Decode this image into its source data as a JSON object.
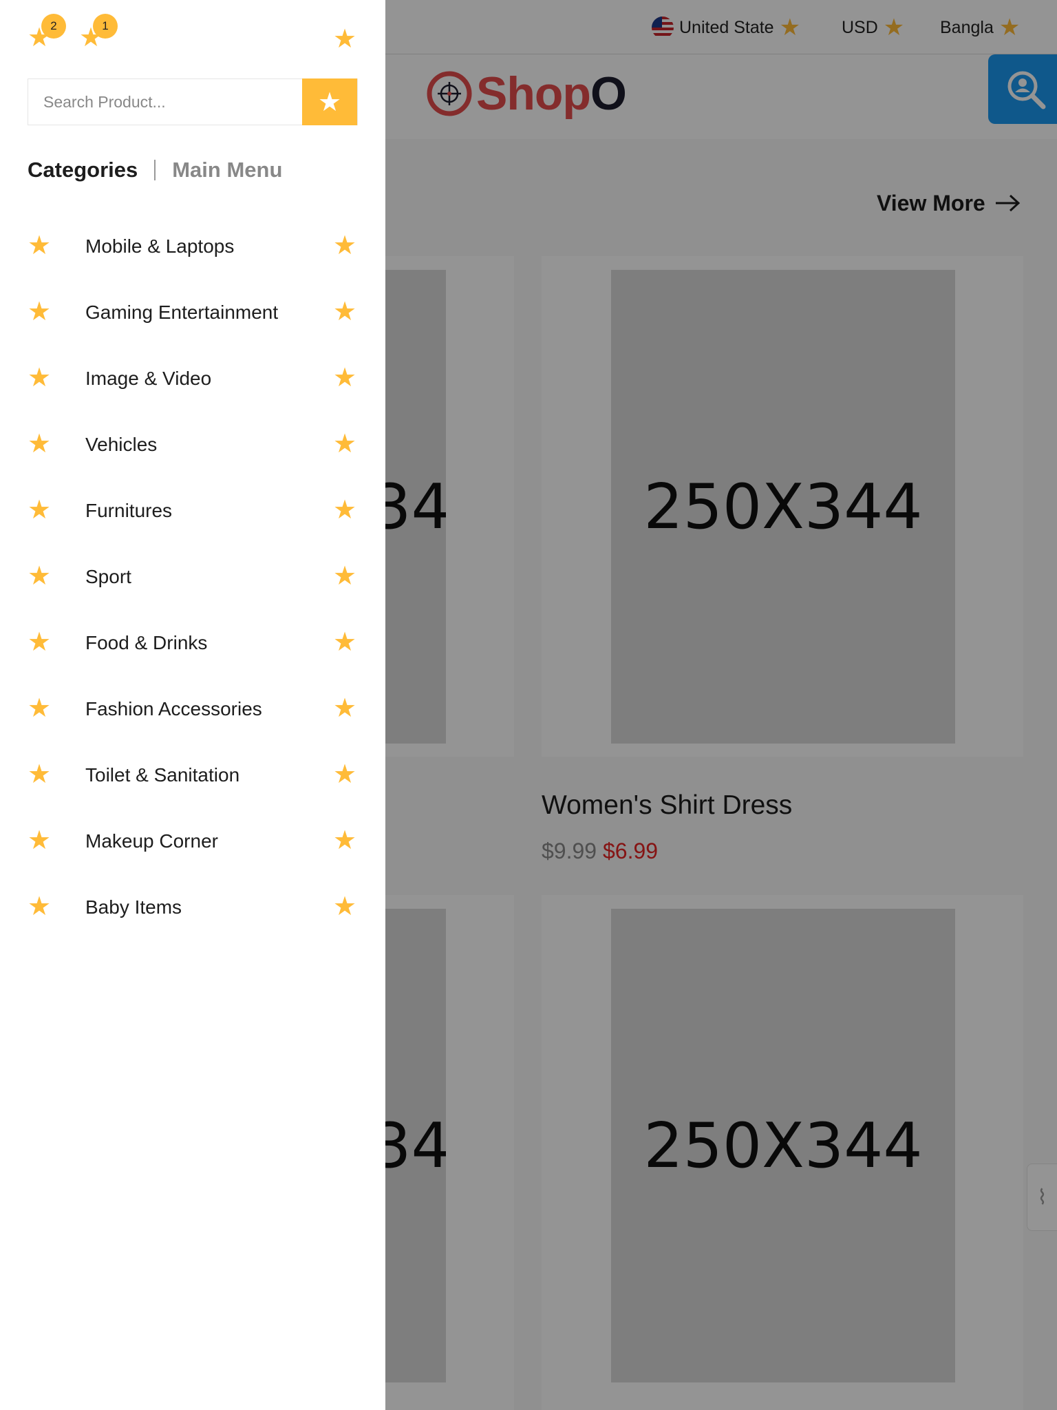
{
  "topbar": {
    "country": "United State",
    "currency": "USD",
    "language": "Bangla"
  },
  "logo": {
    "part1": "Shop",
    "part2": "O"
  },
  "section": {
    "view_more": "View More"
  },
  "product": {
    "placeholder": "250X344",
    "title": "Women's Shirt Dress",
    "old_price": "$9.99",
    "new_price": "$6.99"
  },
  "drawer": {
    "wishlist_count": "2",
    "cart_count": "1",
    "search_placeholder": "Search Product...",
    "tabs": {
      "categories": "Categories",
      "main_menu": "Main Menu"
    },
    "categories": [
      {
        "label": "Mobile & Laptops"
      },
      {
        "label": "Gaming Entertainment"
      },
      {
        "label": "Image & Video"
      },
      {
        "label": "Vehicles"
      },
      {
        "label": "Furnitures"
      },
      {
        "label": "Sport"
      },
      {
        "label": "Food & Drinks"
      },
      {
        "label": "Fashion Accessories"
      },
      {
        "label": "Toilet & Sanitation"
      },
      {
        "label": "Makeup Corner"
      },
      {
        "label": "Baby Items"
      }
    ]
  },
  "colors": {
    "accent": "#ffbb38",
    "fab": "#1a98f0",
    "sale_price": "#e52424",
    "brand_red": "#e44d4d"
  },
  "icons": {
    "glyph": "star-icon",
    "search_fab": "user-search-icon",
    "logo_mark": "crosshair-icon",
    "view_more": "arrow-right-icon"
  }
}
